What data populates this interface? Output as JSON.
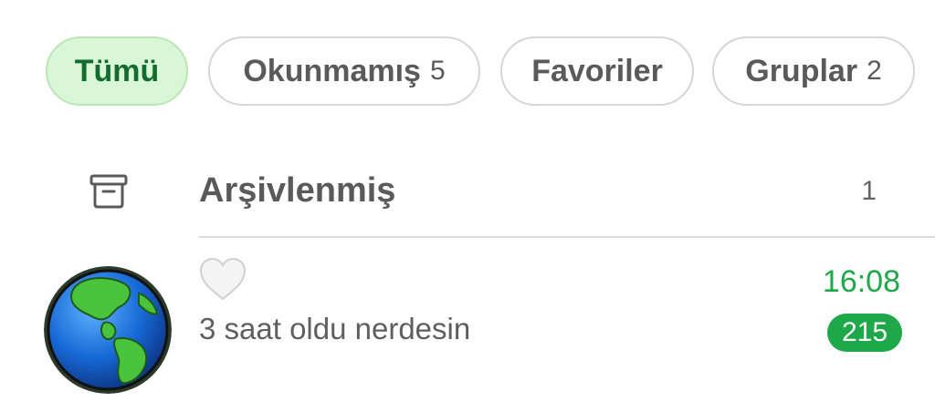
{
  "filters": {
    "chips": [
      {
        "label": "Tümü",
        "active": true
      },
      {
        "label": "Okunmamış",
        "count": "5",
        "active": false
      },
      {
        "label": "Favoriler",
        "active": false
      },
      {
        "label": "Gruplar",
        "count": "2",
        "active": false
      }
    ]
  },
  "archived": {
    "icon": "archive-box-icon",
    "label": "Arşivlenmiş",
    "count": "1"
  },
  "chats": [
    {
      "avatar_icon": "globe-icon",
      "name_icon": "white-heart-emoji",
      "preview": "3 saat oldu nerdesin",
      "time": "16:08",
      "unread": "215"
    }
  ],
  "colors": {
    "accent_green": "#1ea84a",
    "active_chip_bg": "#d9f7d6",
    "active_chip_text": "#136b2e",
    "chip_border": "#d6d6d6",
    "text_gray": "#5a5a5a"
  }
}
